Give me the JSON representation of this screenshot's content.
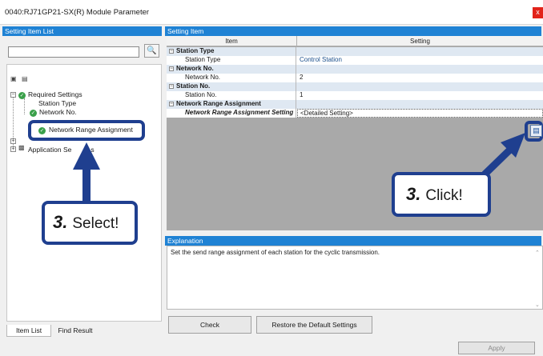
{
  "window": {
    "title": "0040:RJ71GP21-SX(R) Module Parameter",
    "close_label": "x"
  },
  "left_panel": {
    "header": "Setting Item List",
    "search_value": "",
    "search_icon": "binoculars-icon",
    "tree": {
      "toolbar_icons": [
        "expand-all-icon",
        "collapse-all-icon"
      ],
      "required_settings": "Required Settings",
      "station_type": "Station Type",
      "network_no": "Network No.",
      "network_range_assignment": "Network Range Assignment",
      "application_settings_partial": "Application Se",
      "application_settings_partial_tail": "s"
    },
    "tabs": [
      "Item List",
      "Find Result"
    ]
  },
  "right_panel": {
    "header": "Setting Item",
    "columns": {
      "item": "Item",
      "setting": "Setting"
    },
    "rows": [
      {
        "item": "Station Type",
        "setting": ""
      },
      {
        "item": "Station Type",
        "setting": "Control Station"
      },
      {
        "item": "Network No.",
        "setting": ""
      },
      {
        "item": "Network No.",
        "setting": "2"
      },
      {
        "item": "Station No.",
        "setting": ""
      },
      {
        "item": "Station No.",
        "setting": "1"
      },
      {
        "item": "Network Range Assignment",
        "setting": ""
      },
      {
        "item": "Network Range Assignment Setting",
        "setting": "<Detailed Setting>"
      }
    ],
    "explanation_header": "Explanation",
    "explanation_text": "Set the send range assignment of each station for the cyclic transmission."
  },
  "buttons": {
    "check": "Check",
    "restore": "Restore the Default Settings",
    "apply": "Apply"
  },
  "callouts": {
    "select_number": "3.",
    "select_text": "Select!",
    "click_number": "3.",
    "click_text": "Click!"
  },
  "colors": {
    "accent": "#1f82d4",
    "callout_border": "#1f3f8f",
    "check_green": "#3aa04a"
  }
}
